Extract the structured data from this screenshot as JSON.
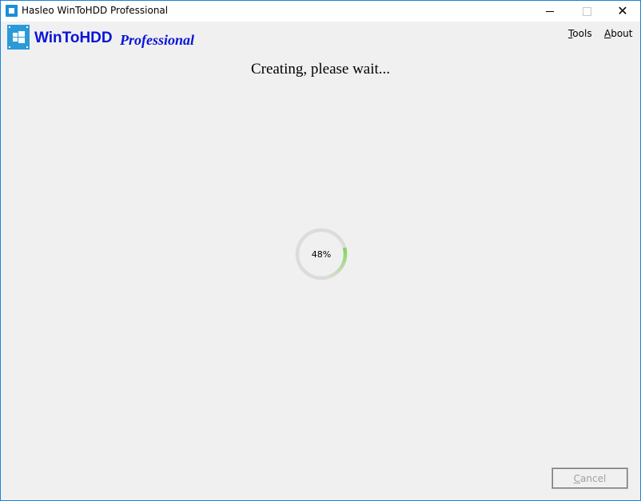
{
  "window": {
    "title": "Hasleo WinToHDD Professional",
    "controls": {
      "minimize": "minimize",
      "maximize": "maximize",
      "close": "✕"
    }
  },
  "header": {
    "app_name": "WinToHDD",
    "edition": "Professional"
  },
  "menu": {
    "tools": {
      "accel": "T",
      "rest": "ools"
    },
    "about": {
      "accel": "A",
      "rest": "bout"
    }
  },
  "main": {
    "status": "Creating, please wait...",
    "progress": {
      "percent": 48,
      "label": "48%",
      "accent_color": "#7fd64f",
      "track_color": "#dcdcdc"
    }
  },
  "footer": {
    "cancel": {
      "accel": "C",
      "rest": "ancel",
      "enabled": false
    }
  }
}
